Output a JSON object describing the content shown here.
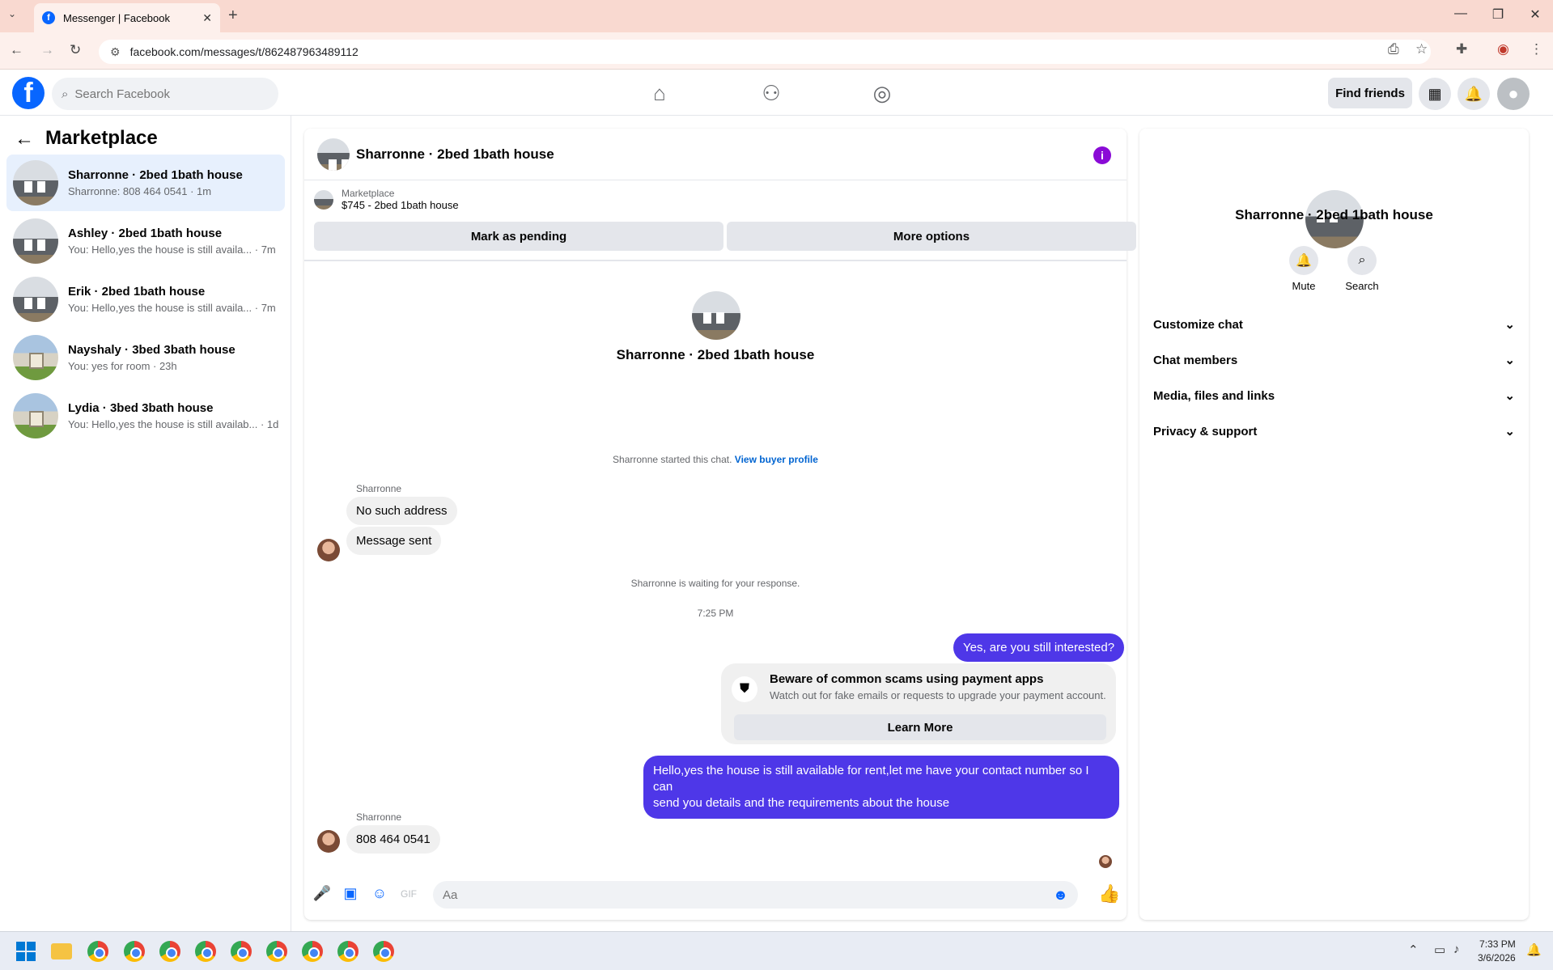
{
  "browser": {
    "tab_title": "Messenger | Facebook",
    "url": "facebook.com/messages/t/862487963489112"
  },
  "header": {
    "search_placeholder": "Search Facebook",
    "find_friends": "Find friends"
  },
  "left": {
    "title": "Marketplace",
    "conversations": [
      {
        "name": "Sharronne · 2bed 1bath house",
        "preview": "Sharronne: 808 464 0541 · 1m",
        "thumb": "gray"
      },
      {
        "name": "Ashley · 2bed 1bath house",
        "preview": "You: Hello,yes the house is still availa... · 7m",
        "thumb": "gray"
      },
      {
        "name": "Erik · 2bed 1bath house",
        "preview": "You: Hello,yes the house is still availa... · 7m",
        "thumb": "gray"
      },
      {
        "name": "Nayshaly · 3bed 3bath house",
        "preview": "You: yes for room · 23h",
        "thumb": "green"
      },
      {
        "name": "Lydia · 3bed 3bath house",
        "preview": "You: Hello,yes the house is still availab... · 1d",
        "thumb": "green"
      }
    ]
  },
  "chat": {
    "title": "Sharronne · 2bed 1bath house",
    "listing_label": "Marketplace",
    "listing_desc": "$745 - 2bed 1bath house",
    "mark_pending": "Mark as pending",
    "more_options": "More options",
    "intro_name": "Sharronne · 2bed 1bath house",
    "started": "Sharronne started this chat.",
    "view_profile": "View buyer profile",
    "sender1": "Sharronne",
    "msg1": "No such address",
    "msg2": "Message sent",
    "waiting": "Sharronne is waiting for your response.",
    "time": "7:25 PM",
    "out1": "Yes, are you still interested?",
    "warn_title": "Beware of common scams using payment apps",
    "warn_sub": "Watch out for fake emails or requests to upgrade your payment account.",
    "learn_more": "Learn More",
    "out2_line1": "Hello,yes the house is still available for rent,let me have your contact number so I can",
    "out2_line2": "send you details and the requirements about the house",
    "sender2": "Sharronne",
    "msg3": "808 464 0541",
    "composer_placeholder": "Aa"
  },
  "right": {
    "name": "Sharronne · 2bed 1bath house",
    "mute": "Mute",
    "search": "Search",
    "sections": [
      "Customize chat",
      "Chat members",
      "Media, files and links",
      "Privacy & support"
    ]
  },
  "taskbar": {
    "time": "7:33 PM",
    "date": "3/6/2026"
  },
  "colors": {
    "accent": "#0866ff",
    "outgoing_bubble": "#4e37e8",
    "active_row": "#e7f0fd"
  }
}
